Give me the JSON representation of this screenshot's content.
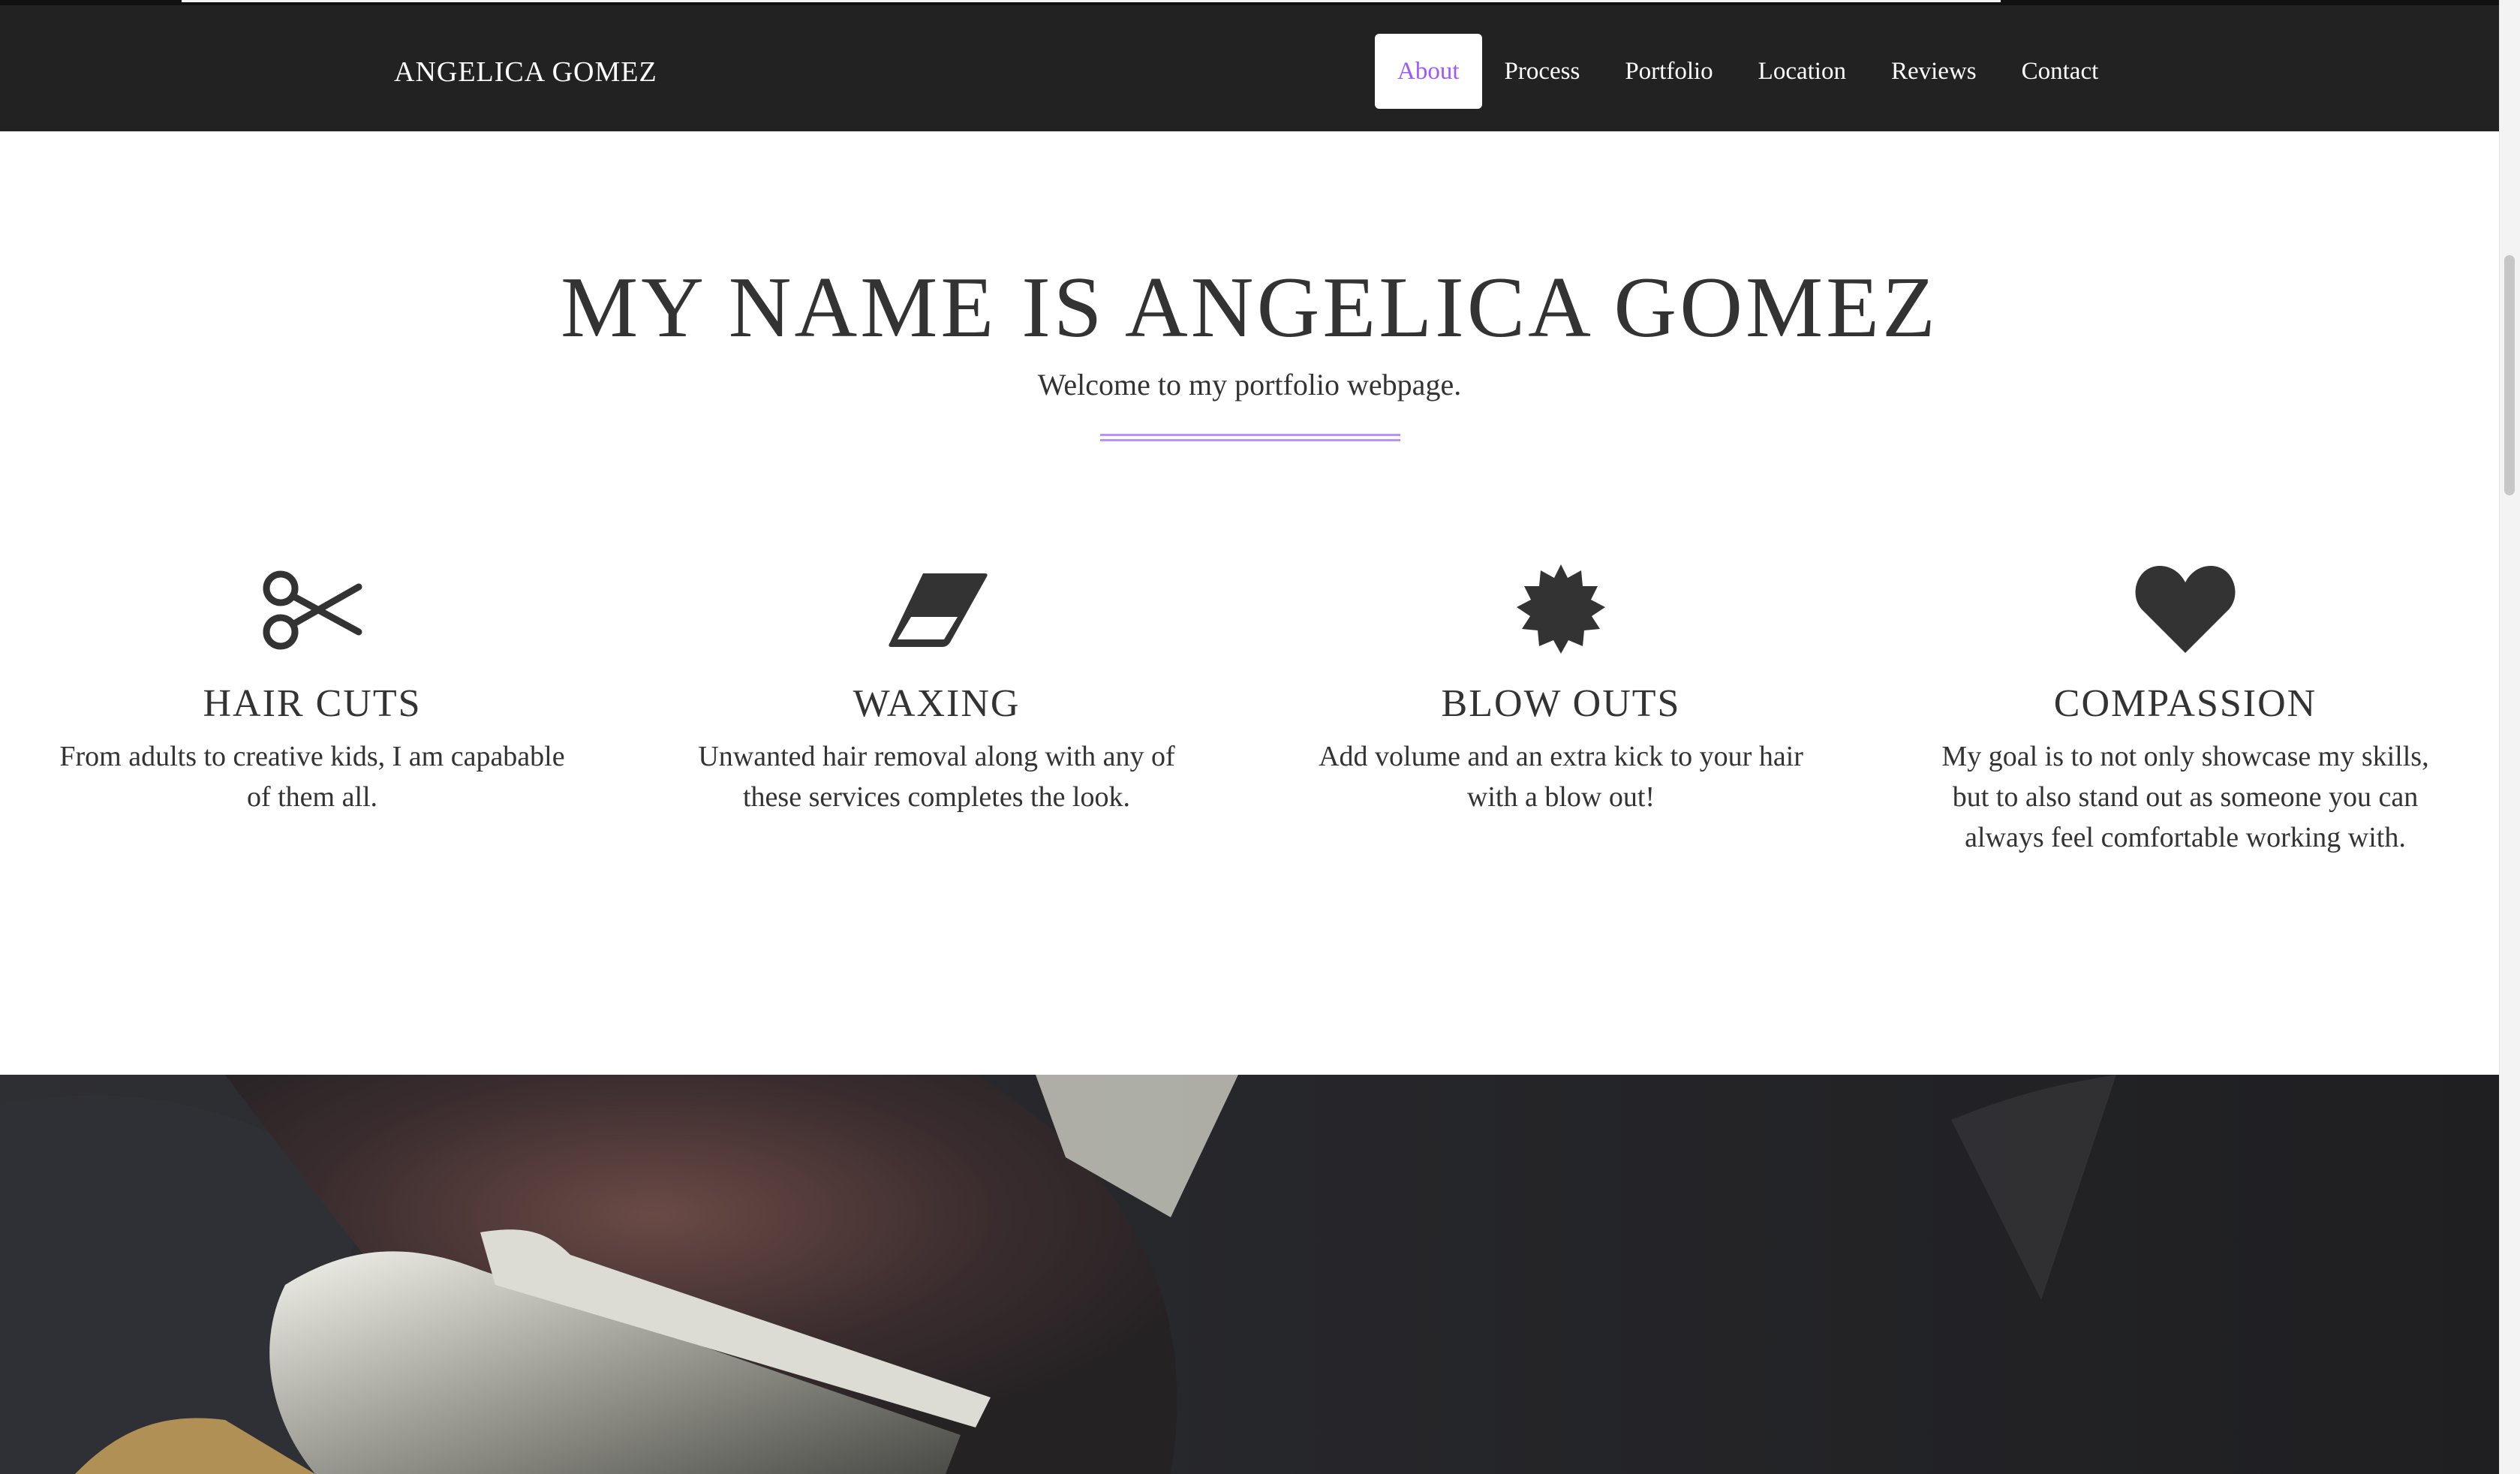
{
  "header": {
    "brand": "ANGELICA GOMEZ",
    "nav": [
      {
        "label": "About",
        "active": true
      },
      {
        "label": "Process",
        "active": false
      },
      {
        "label": "Portfolio",
        "active": false
      },
      {
        "label": "Location",
        "active": false
      },
      {
        "label": "Reviews",
        "active": false
      },
      {
        "label": "Contact",
        "active": false
      }
    ]
  },
  "hero": {
    "title": "MY NAME IS ANGELICA GOMEZ",
    "subtitle": "Welcome to my portfolio webpage."
  },
  "services": [
    {
      "icon": "scissors-icon",
      "title": "HAIR CUTS",
      "text": "From adults to creative kids, I am capabable of them all."
    },
    {
      "icon": "eraser-icon",
      "title": "WAXING",
      "text": "Unwanted hair removal along with any of these services completes the look."
    },
    {
      "icon": "badge-icon",
      "title": "BLOW OUTS",
      "text": "Add volume and an extra kick to your hair with a blow out!"
    },
    {
      "icon": "heart-icon",
      "title": "COMPASSION",
      "text": "My goal is to not only showcase my skills, but to also stand out as someone you can always feel comfortable working with."
    }
  ],
  "colors": {
    "navbar": "#222222",
    "accent": "#9b59ff",
    "divider": "#b794f6",
    "text": "#333333"
  }
}
